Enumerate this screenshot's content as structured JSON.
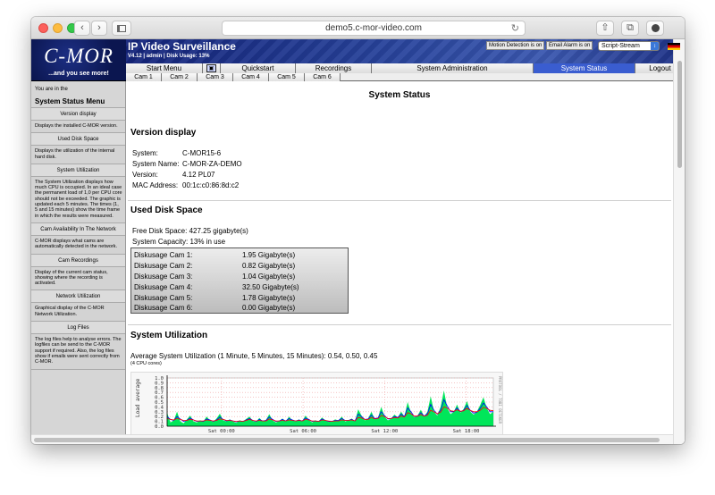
{
  "browser": {
    "url": "demo5.c-mor-video.com",
    "back_icon": "chevron-left",
    "forward_icon": "chevron-right",
    "new_tab": "+"
  },
  "header": {
    "logo": "C-MOR",
    "logo_tagline": "...and you see more!",
    "app_title": "IP Video Surveillance",
    "version_line": "V4.12 | admin | Disk Usage: 13%",
    "motion_detection": "Motion Detection is on",
    "email_alarm": "Email Alarm is on",
    "stream_select": "Script-Stream"
  },
  "mainnav": {
    "start_menu": "Start Menu",
    "quickstart": "Quickstart",
    "recordings": "Recordings",
    "system_administration": "System Administration",
    "system_status": "System Status",
    "logout": "Logout"
  },
  "camnav": [
    "Cam 1",
    "Cam 2",
    "Cam 3",
    "Cam 4",
    "Cam 5",
    "Cam 6"
  ],
  "sidebar": {
    "you_are_in": "You are in the",
    "title": "System Status Menu",
    "sections": [
      {
        "link": "Version display",
        "desc": "Displays the installed C-MOR version."
      },
      {
        "link": "Used Disk Space",
        "desc": "Displays the utilization of the internal hard disk."
      },
      {
        "link": "System Utilization",
        "desc": "The System Utilization displays how much CPU is occupied. In an ideal case the permanent load of 1,0 per CPU core should not be exceeded. The graphic is updated each 5 minutes. The times (1, 5 and 15 minutes) show the time frame in which the results were measured."
      },
      {
        "link": "Cam Availability In The Network",
        "desc": "C-MOR displays what cams are automatically detected in the network."
      },
      {
        "link": "Cam Recordings",
        "desc": "Display of the current cam status, showing where the recording is activated."
      },
      {
        "link": "Network Utilization",
        "desc": "Graphical display of the C-MOR Network Utilization."
      },
      {
        "link": "Log Files",
        "desc": "The log files help to analyse errors. The logfiles can be send to the C-MOR support if required. Also, the log files show if emails were sent correctly from C-MOR."
      }
    ]
  },
  "content": {
    "page_title": "System Status",
    "version": {
      "heading": "Version display",
      "rows": [
        {
          "k": "System:",
          "v": "C-MOR15-6"
        },
        {
          "k": "System Name:",
          "v": "C-MOR-ZA-DEMO"
        },
        {
          "k": "Version:",
          "v": "4.12 PL07"
        },
        {
          "k": "MAC Address:",
          "v": "00:1c:c0:86:8d:c2"
        }
      ]
    },
    "disk": {
      "heading": "Used Disk Space",
      "free": "Free Disk Space:  427.25 gigabyte(s)",
      "capacity": "System Capacity:  13% in use",
      "rows": [
        {
          "n": "Diskusage Cam 1:",
          "v": "1.95 Gigabyte(s)"
        },
        {
          "n": "Diskusage Cam 2:",
          "v": "0.82 Gigabyte(s)"
        },
        {
          "n": "Diskusage Cam 3:",
          "v": "1.04 Gigabyte(s)"
        },
        {
          "n": "Diskusage Cam 4:",
          "v": "32.50 Gigabyte(s)"
        },
        {
          "n": "Diskusage Cam 5:",
          "v": "1.78 Gigabyte(s)"
        },
        {
          "n": "Diskusage Cam 6:",
          "v": "0.00 Gigabyte(s)"
        }
      ]
    },
    "utilization": {
      "heading": "System Utilization",
      "average": "Average System Utilization (1 Minute, 5 Minutes, 15 Minutes): 0.54, 0.50, 0.45",
      "cpu_note": "(4 CPU cores)"
    }
  },
  "chart_data": {
    "type": "area",
    "ylabel": "Load average",
    "watermark": "PROTOOL / TOBI OETIKER",
    "yticks": [
      "0.0",
      "0.1",
      "0.2",
      "0.3",
      "0.4",
      "0.5",
      "0.6",
      "0.7",
      "0.8",
      "0.9",
      "1.0"
    ],
    "ylim": [
      0,
      1.0
    ],
    "xticks": [
      "Sat 00:00",
      "Sat 06:00",
      "Sat 12:00",
      "Sat 18:00"
    ],
    "colors": {
      "area": "#00e65a",
      "line5": "#0000ff",
      "line15": "#ff0000"
    },
    "load1": [
      0.28,
      0.08,
      0.12,
      0.3,
      0.1,
      0.06,
      0.14,
      0.22,
      0.1,
      0.08,
      0.12,
      0.1,
      0.2,
      0.12,
      0.09,
      0.16,
      0.26,
      0.12,
      0.1,
      0.14,
      0.1,
      0.07,
      0.12,
      0.1,
      0.15,
      0.2,
      0.11,
      0.09,
      0.17,
      0.1,
      0.13,
      0.25,
      0.12,
      0.08,
      0.11,
      0.16,
      0.1,
      0.2,
      0.12,
      0.1,
      0.14,
      0.1,
      0.22,
      0.13,
      0.08,
      0.12,
      0.1,
      0.18,
      0.12,
      0.09,
      0.1,
      0.14,
      0.12,
      0.2,
      0.1,
      0.12,
      0.16,
      0.1,
      0.35,
      0.22,
      0.12,
      0.16,
      0.3,
      0.14,
      0.18,
      0.4,
      0.2,
      0.12,
      0.16,
      0.24,
      0.18,
      0.3,
      0.2,
      0.5,
      0.28,
      0.18,
      0.22,
      0.34,
      0.2,
      0.3,
      0.62,
      0.3,
      0.22,
      0.4,
      0.74,
      0.38,
      0.25,
      0.3,
      0.45,
      0.28,
      0.36,
      0.52,
      0.3,
      0.24,
      0.3,
      0.44,
      0.6,
      0.38,
      0.25,
      0.3
    ],
    "load5": [
      0.2,
      0.14,
      0.12,
      0.2,
      0.15,
      0.1,
      0.12,
      0.17,
      0.13,
      0.1,
      0.11,
      0.1,
      0.15,
      0.13,
      0.1,
      0.13,
      0.19,
      0.14,
      0.11,
      0.13,
      0.11,
      0.09,
      0.11,
      0.1,
      0.13,
      0.16,
      0.12,
      0.1,
      0.14,
      0.11,
      0.12,
      0.19,
      0.14,
      0.1,
      0.11,
      0.14,
      0.11,
      0.16,
      0.13,
      0.11,
      0.13,
      0.11,
      0.17,
      0.14,
      0.1,
      0.11,
      0.1,
      0.15,
      0.12,
      0.1,
      0.1,
      0.12,
      0.12,
      0.16,
      0.12,
      0.12,
      0.14,
      0.11,
      0.25,
      0.2,
      0.14,
      0.15,
      0.23,
      0.16,
      0.17,
      0.3,
      0.22,
      0.15,
      0.16,
      0.2,
      0.18,
      0.25,
      0.2,
      0.38,
      0.3,
      0.2,
      0.21,
      0.28,
      0.21,
      0.26,
      0.45,
      0.33,
      0.25,
      0.33,
      0.55,
      0.42,
      0.3,
      0.3,
      0.38,
      0.3,
      0.33,
      0.43,
      0.33,
      0.27,
      0.29,
      0.37,
      0.48,
      0.4,
      0.3,
      0.3
    ],
    "load15": [
      0.16,
      0.14,
      0.13,
      0.16,
      0.14,
      0.12,
      0.12,
      0.14,
      0.13,
      0.11,
      0.11,
      0.11,
      0.13,
      0.12,
      0.11,
      0.12,
      0.15,
      0.14,
      0.12,
      0.12,
      0.11,
      0.1,
      0.11,
      0.1,
      0.12,
      0.14,
      0.12,
      0.11,
      0.12,
      0.11,
      0.11,
      0.15,
      0.13,
      0.11,
      0.11,
      0.12,
      0.11,
      0.13,
      0.12,
      0.11,
      0.12,
      0.11,
      0.14,
      0.13,
      0.11,
      0.11,
      0.1,
      0.13,
      0.12,
      0.11,
      0.1,
      0.11,
      0.11,
      0.13,
      0.12,
      0.12,
      0.13,
      0.11,
      0.18,
      0.17,
      0.14,
      0.14,
      0.18,
      0.15,
      0.16,
      0.22,
      0.2,
      0.16,
      0.16,
      0.18,
      0.17,
      0.21,
      0.19,
      0.28,
      0.26,
      0.21,
      0.21,
      0.24,
      0.21,
      0.23,
      0.33,
      0.3,
      0.26,
      0.29,
      0.4,
      0.38,
      0.32,
      0.31,
      0.34,
      0.31,
      0.32,
      0.37,
      0.33,
      0.3,
      0.3,
      0.33,
      0.39,
      0.37,
      0.33,
      0.32
    ]
  }
}
